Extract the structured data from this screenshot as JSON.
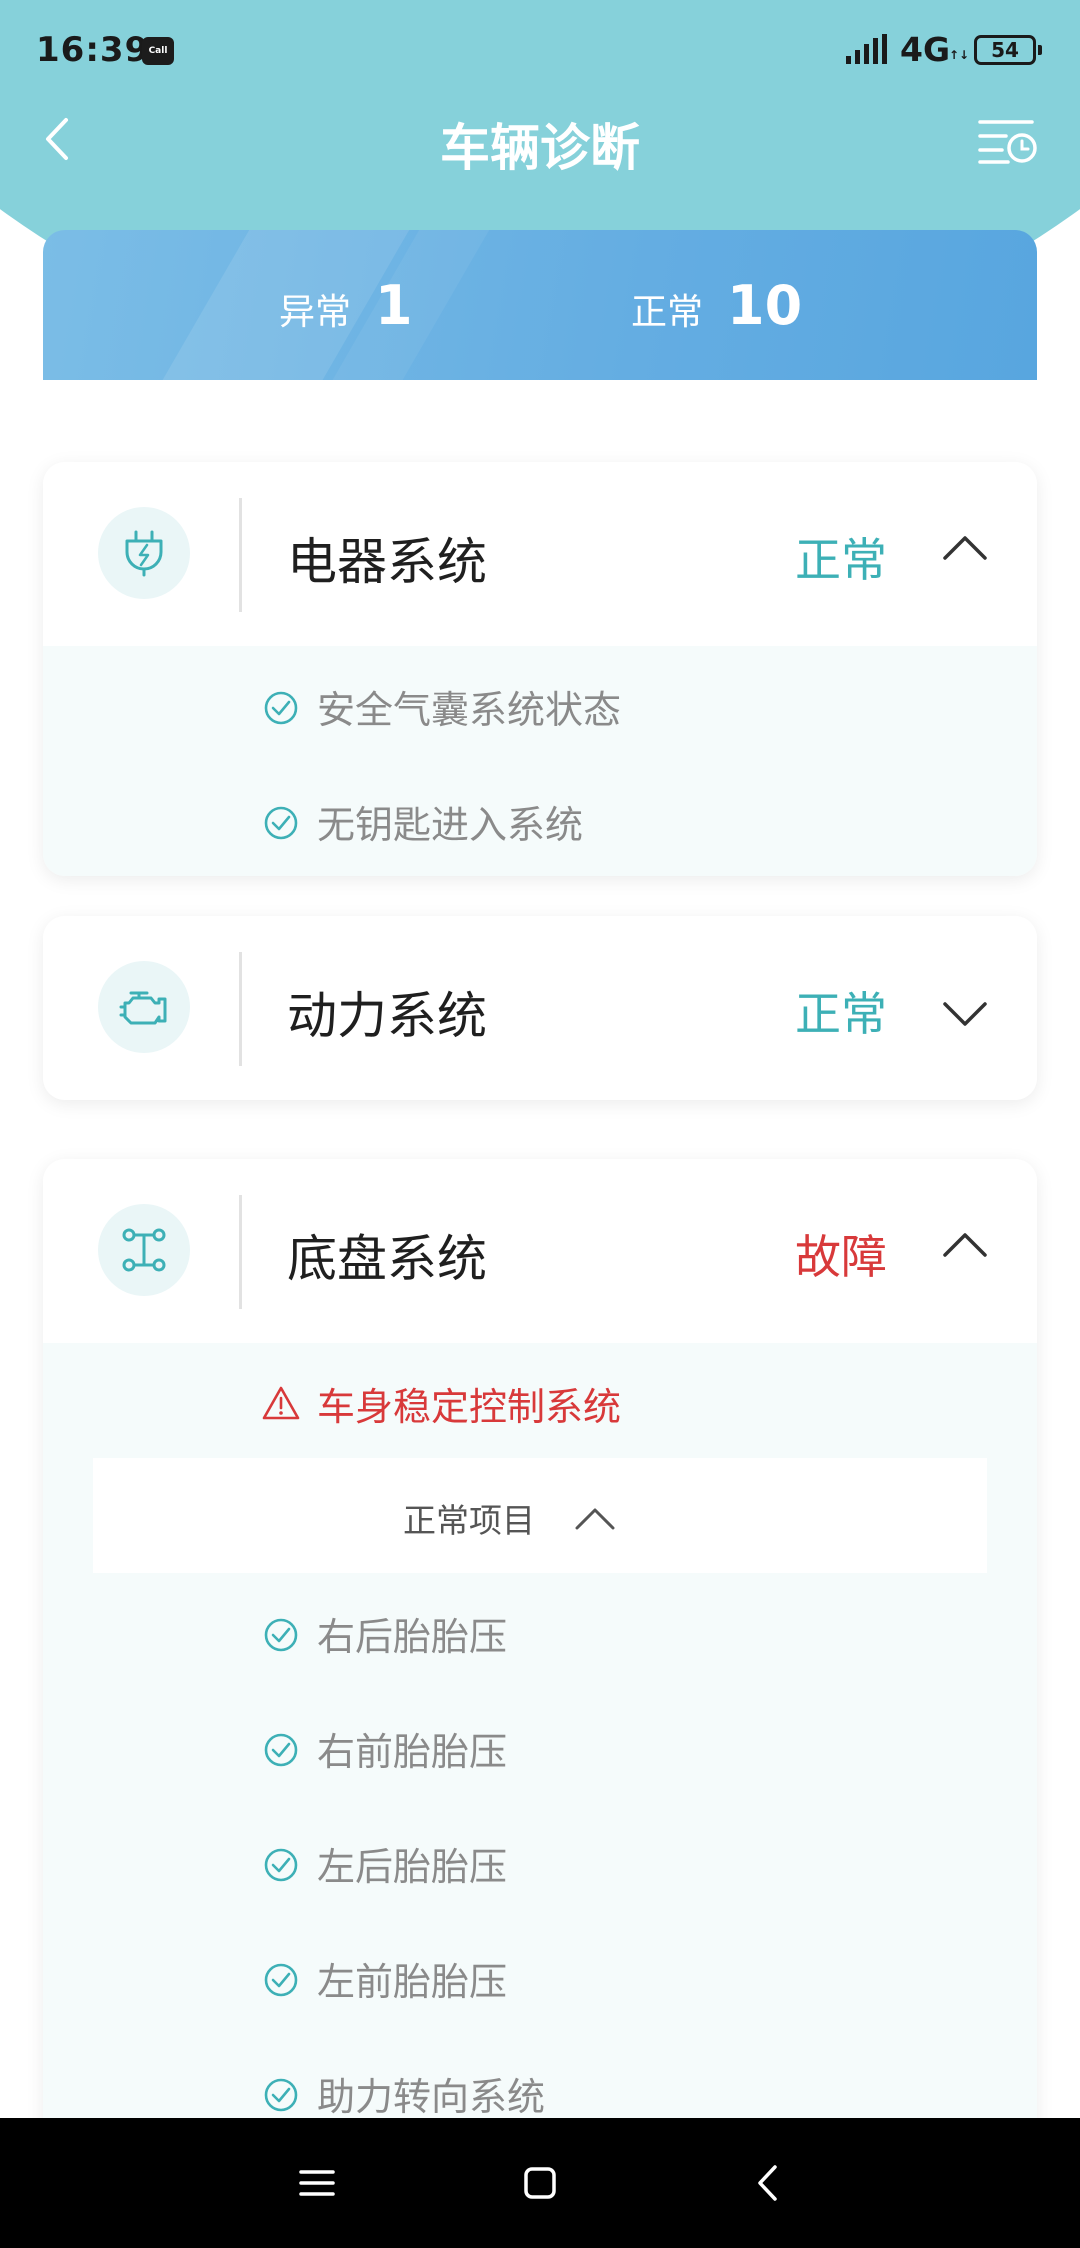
{
  "status_bar": {
    "time": "16:39",
    "app_badge": "Call",
    "network": "4G",
    "network_arrows": "↑↓",
    "battery": "54"
  },
  "header": {
    "title": "车辆诊断"
  },
  "summary": {
    "abnormal_label": "异常",
    "abnormal_count": "1",
    "normal_label": "正常",
    "normal_count": "10"
  },
  "systems": [
    {
      "name": "电器系统",
      "status": "正常",
      "expanded": true,
      "icon": "plug-bolt-icon",
      "items": [
        "安全气囊系统状态",
        "无钥匙进入系统"
      ]
    },
    {
      "name": "动力系统",
      "status": "正常",
      "expanded": false,
      "icon": "engine-icon",
      "items": []
    },
    {
      "name": "底盘系统",
      "status": "故障",
      "expanded": true,
      "icon": "chassis-icon",
      "fault_items": [
        "车身稳定控制系统"
      ],
      "normal_toggle_label": "正常项目",
      "items": [
        "右后胎胎压",
        "右前胎胎压",
        "左后胎胎压",
        "左前胎胎压",
        "助力转向系统"
      ]
    }
  ],
  "colors": {
    "header_bg": "#86d1da",
    "summary_card": "#64ade2",
    "status_ok": "#3db0b6",
    "status_fault": "#d8393a"
  }
}
